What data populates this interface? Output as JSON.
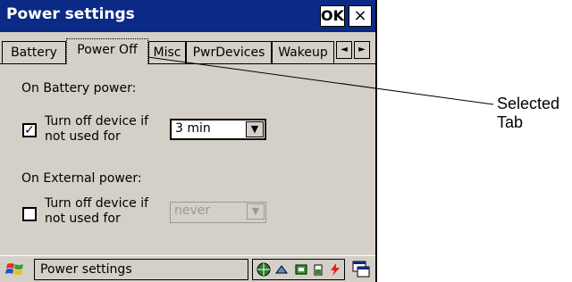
{
  "window": {
    "title": "Power settings",
    "ok_label": "OK",
    "close_label": "×"
  },
  "tabs": [
    {
      "label": "Battery",
      "selected": false
    },
    {
      "label": "Power Off",
      "selected": true
    },
    {
      "label": "Misc",
      "selected": false
    },
    {
      "label": "PwrDevices",
      "selected": false
    },
    {
      "label": "Wakeup",
      "selected": false
    }
  ],
  "tab_scroll": {
    "left_icon": "◄",
    "right_icon": "►"
  },
  "battery": {
    "heading": "On Battery power:",
    "checkbox_checked": true,
    "checkbox_mark": "✓",
    "line1": "Turn off device if",
    "line2": "not used for",
    "select_value": "3 min"
  },
  "external": {
    "heading": "On External power:",
    "checkbox_checked": false,
    "line1": "Turn off device if",
    "line2": "not used for",
    "select_value": "never",
    "select_enabled": false
  },
  "combo_arrow": "▼",
  "taskbar": {
    "task_label": "Power settings"
  },
  "annotation": {
    "text": "Selected Tab"
  }
}
